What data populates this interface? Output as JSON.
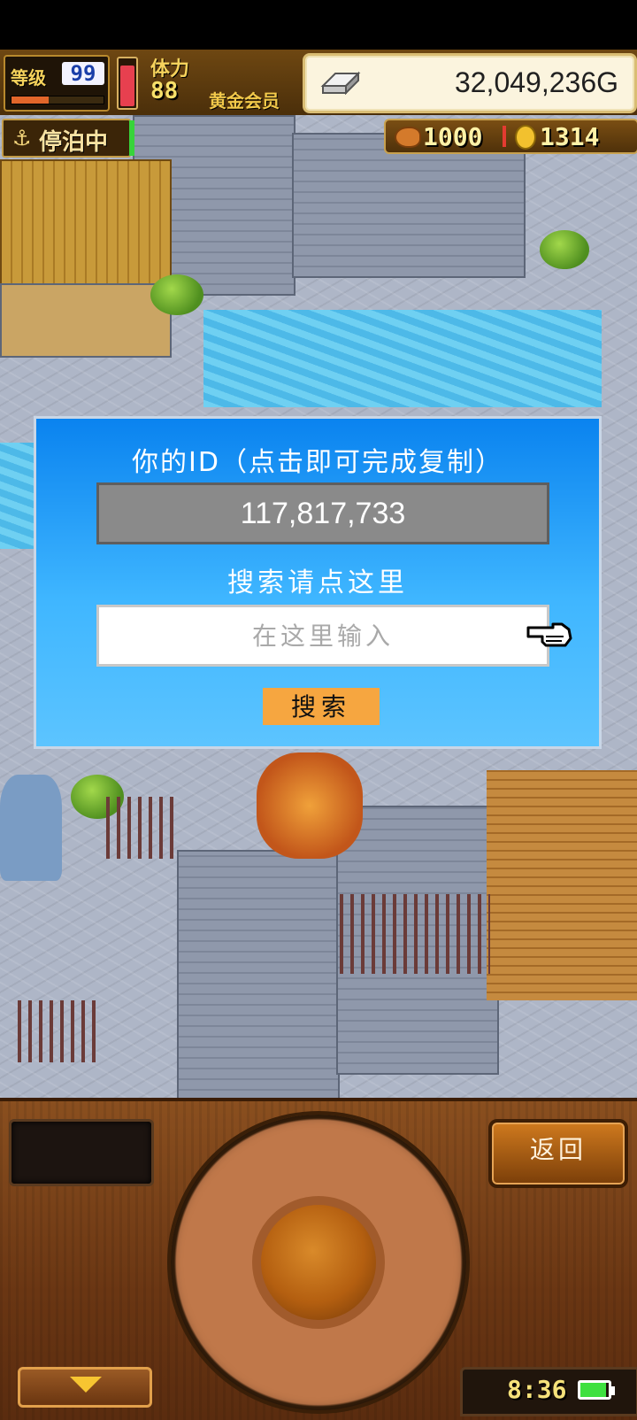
{
  "hud": {
    "level_label": "等级",
    "level_value": "99",
    "level_progress": 0.4,
    "stamina_label": "体力",
    "stamina_value": "88",
    "stamina_level": 0.9,
    "member_label": "黄金会员",
    "gold_value": "32,049,236G",
    "docked_label": "停泊中",
    "meat_value": "1000",
    "coin_value": "1314"
  },
  "dialog": {
    "title": "你的ID（点击即可完成复制）",
    "id_value": "117,817,733",
    "search_label": "搜索请点这里",
    "search_placeholder": "在这里输入",
    "search_button": "搜索"
  },
  "controls": {
    "back_label": "返回",
    "clock": "8:36",
    "battery_level": 0.9
  },
  "colors": {
    "dialog_top": "#0a83ef",
    "dialog_bottom": "#5cc4ff",
    "search_button": "#f6a640",
    "panel_wood": "#6a3613"
  },
  "icons": {
    "anchor": "anchor-icon",
    "silver": "silver-bar-icon",
    "meat": "meat-icon",
    "coin": "coin-icon",
    "pointer": "pointer-hand-icon",
    "battery": "battery-icon"
  }
}
